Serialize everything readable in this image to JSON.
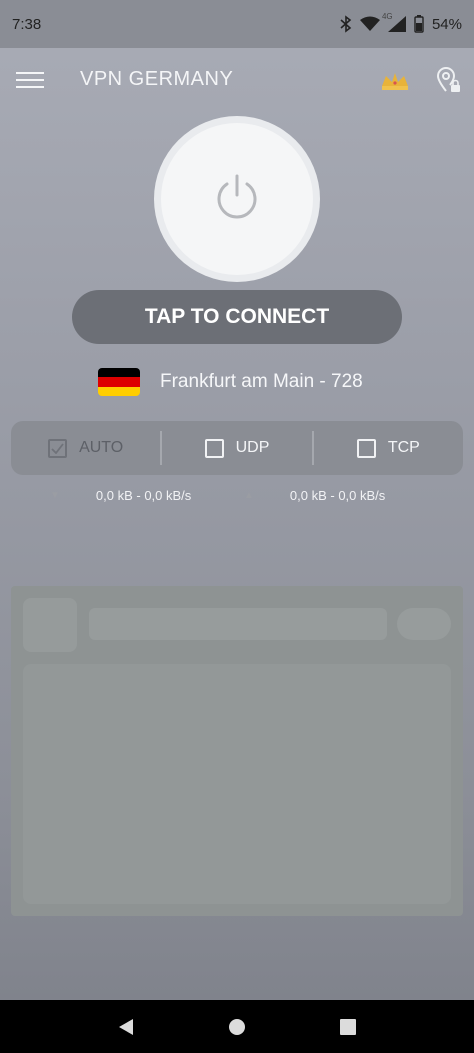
{
  "status_bar": {
    "time": "7:38",
    "network": "4G",
    "battery": "54%"
  },
  "app_bar": {
    "title": "VPN GERMANY",
    "icons": [
      "menu-icon",
      "crown-icon",
      "location-lock-icon"
    ]
  },
  "main": {
    "connect_label": "TAP TO CONNECT",
    "server": {
      "name": "Frankfurt am Main - 728",
      "flag": "germany-flag-icon"
    },
    "protocols": [
      {
        "label": "AUTO",
        "checked": true
      },
      {
        "label": "UDP",
        "checked": false
      },
      {
        "label": "TCP",
        "checked": false
      }
    ],
    "traffic": [
      {
        "value": "0,0 kB - 0,0 kB/s"
      },
      {
        "value": "0,0 kB - 0,0 kB/s"
      }
    ]
  },
  "colors": {
    "connect_button": "#6c6f76",
    "crown": "#e8b33a",
    "flag_black": "#000000",
    "flag_red": "#dd0000",
    "flag_gold": "#ffce00"
  }
}
